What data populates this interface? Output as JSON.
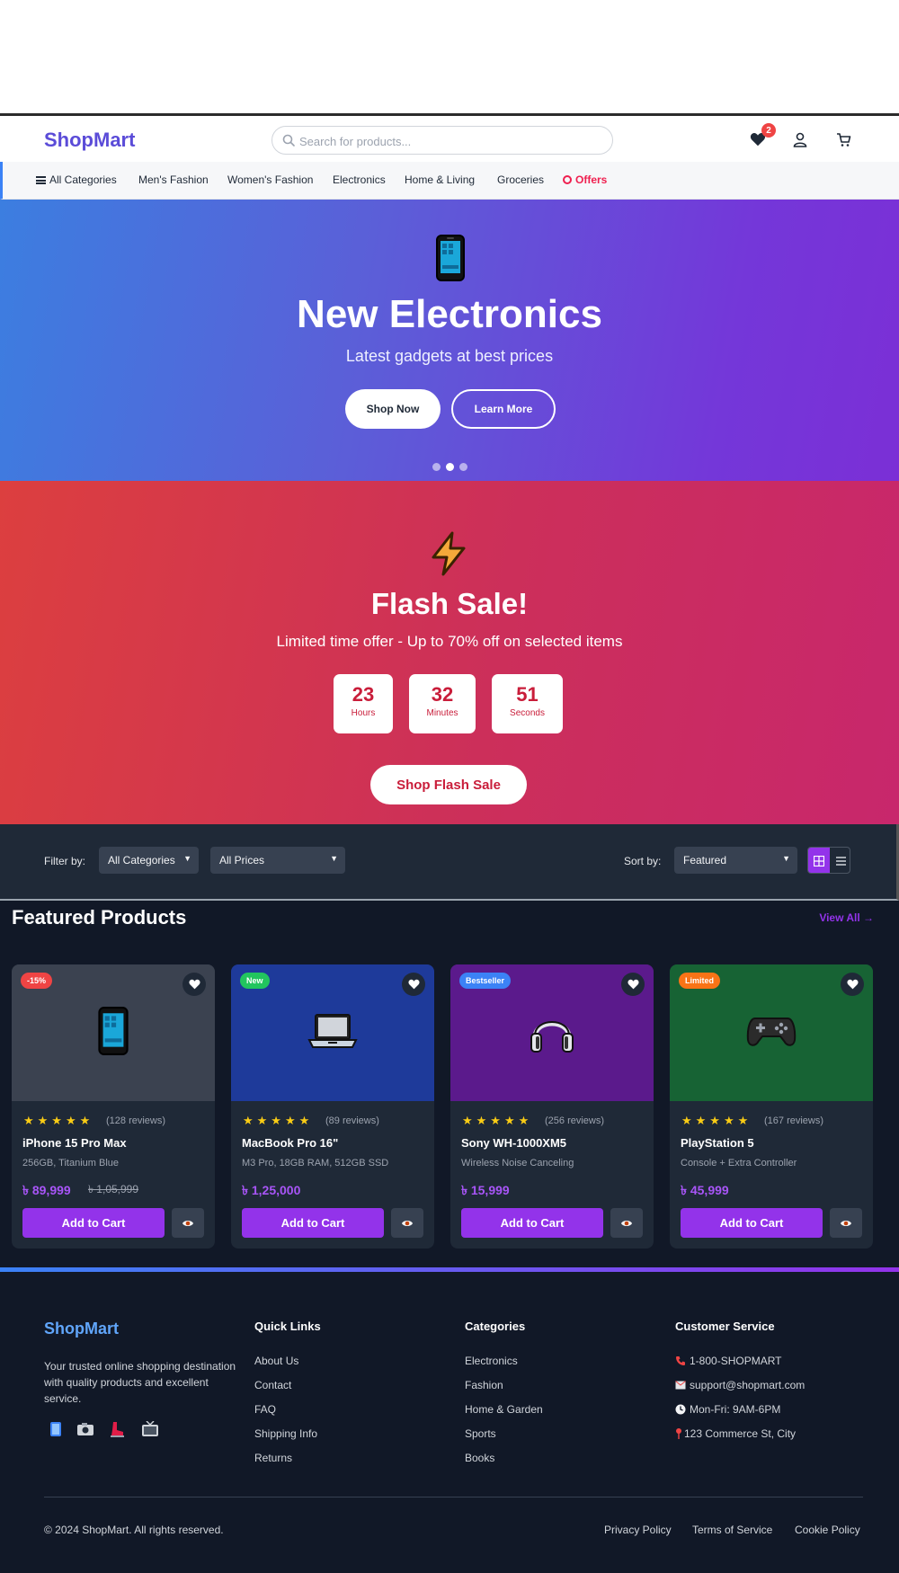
{
  "header": {
    "logo": "ShopMart",
    "search_placeholder": "Search for products...",
    "wishlist_count": "2"
  },
  "categories_nav": {
    "all": "All Categories",
    "items": [
      "Men's Fashion",
      "Women's Fashion",
      "Electronics",
      "Home & Living",
      "Groceries"
    ],
    "offers": "Offers"
  },
  "hero": {
    "icon": "smartphone-icon",
    "title": "New Electronics",
    "subtitle": "Latest gadgets at best prices",
    "primary_button": "Shop Now",
    "secondary_button": "Learn More",
    "slide_count": 3,
    "active_slide": 2
  },
  "flash_sale": {
    "icon": "lightning-icon",
    "title": "Flash Sale!",
    "subtitle": "Limited time offer - Up to 70% off on selected items",
    "countdown": [
      {
        "value": "23",
        "label": "Hours"
      },
      {
        "value": "32",
        "label": "Minutes"
      },
      {
        "value": "51",
        "label": "Seconds"
      }
    ],
    "button": "Shop Flash Sale"
  },
  "filters": {
    "filter_label": "Filter by:",
    "category_selected": "All Categories",
    "price_selected": "All Prices",
    "sort_label": "Sort by:",
    "sort_selected": "Featured"
  },
  "featured": {
    "title": "Featured Products",
    "view_all": "View All →",
    "products": [
      {
        "tag": "-15%",
        "tag_color": "#ef4444",
        "bg": "#3b4250",
        "icon": "smartphone-icon",
        "rating": 5,
        "reviews": "(128 reviews)",
        "name": "iPhone 15 Pro Max",
        "desc": "256GB, Titanium Blue",
        "price": "৳ 89,999",
        "old_price": "৳ 1,05,999",
        "add_label": "Add to Cart"
      },
      {
        "tag": "New",
        "tag_color": "#22c55e",
        "bg": "#1e3a9a",
        "icon": "laptop-icon",
        "rating": 5,
        "reviews": "(89 reviews)",
        "name": "MacBook Pro 16\"",
        "desc": "M3 Pro, 18GB RAM, 512GB SSD",
        "price": "৳ 1,25,000",
        "old_price": "",
        "add_label": "Add to Cart"
      },
      {
        "tag": "Bestseller",
        "tag_color": "#3b82f6",
        "bg": "#5b1a8c",
        "icon": "headphones-icon",
        "rating": 5,
        "reviews": "(256 reviews)",
        "name": "Sony WH-1000XM5",
        "desc": "Wireless Noise Canceling",
        "price": "৳ 15,999",
        "old_price": "",
        "add_label": "Add to Cart"
      },
      {
        "tag": "Limited",
        "tag_color": "#f97316",
        "bg": "#176334",
        "icon": "gamepad-icon",
        "rating": 5,
        "reviews": "(167 reviews)",
        "name": "PlayStation 5",
        "desc": "Console + Extra Controller",
        "price": "৳ 45,999",
        "old_price": "",
        "add_label": "Add to Cart"
      }
    ]
  },
  "footer": {
    "logo": "ShopMart",
    "about": "Your trusted online shopping destination with quality products and excellent service.",
    "social_icons": [
      "facebook-icon",
      "instagram-icon",
      "twitter-icon",
      "youtube-icon"
    ],
    "quick_links_title": "Quick Links",
    "quick_links": [
      "About Us",
      "Contact",
      "FAQ",
      "Shipping Info",
      "Returns"
    ],
    "categories_title": "Categories",
    "categories": [
      "Electronics",
      "Fashion",
      "Home & Garden",
      "Sports",
      "Books"
    ],
    "service_title": "Customer Service",
    "service": [
      {
        "icon": "phone-icon",
        "text": "1-800-SHOPMART"
      },
      {
        "icon": "mail-icon",
        "text": "support@shopmart.com"
      },
      {
        "icon": "clock-icon",
        "text": "Mon-Fri: 9AM-6PM"
      },
      {
        "icon": "location-pin-icon",
        "text": "123 Commerce St, City"
      }
    ],
    "copyright": "© 2024 ShopMart. All rights reserved.",
    "legal": [
      "Privacy Policy",
      "Terms of Service",
      "Cookie Policy"
    ]
  },
  "colors": {
    "accent": "#9333ea",
    "brand": "#5b4cd8",
    "flash_red": "#c91d3a"
  }
}
